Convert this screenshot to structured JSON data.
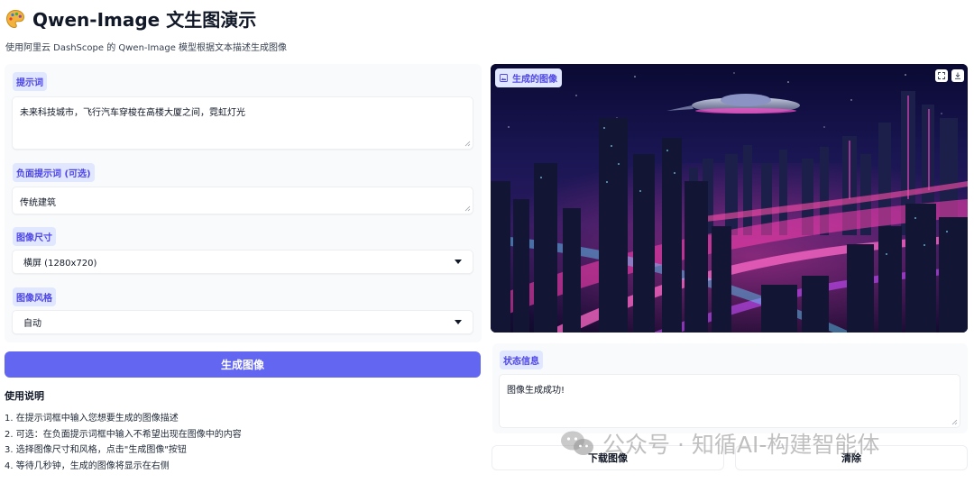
{
  "header": {
    "title": "Qwen-Image 文生图演示",
    "subtitle": "使用阿里云 DashScope 的 Qwen-Image 模型根据文本描述生成图像"
  },
  "form": {
    "prompt": {
      "label": "提示词",
      "value": "未来科技城市，飞行汽车穿梭在高楼大厦之间，霓虹灯光"
    },
    "negative_prompt": {
      "label": "负面提示词 (可选)",
      "value": "传统建筑"
    },
    "size": {
      "label": "图像尺寸",
      "selected": "横屏 (1280x720)"
    },
    "style": {
      "label": "图像风格",
      "selected": "自动"
    },
    "generate_button": "生成图像"
  },
  "usage": {
    "title": "使用说明",
    "steps": [
      "1. 在提示词框中输入您想要生成的图像描述",
      "2. 可选：在负面提示词框中输入不希望出现在图像中的内容",
      "3. 选择图像尺寸和风格，点击\"生成图像\"按钮",
      "4. 等待几秒钟，生成的图像将显示在右侧"
    ]
  },
  "output": {
    "image_label": "生成的图像",
    "status_label": "状态信息",
    "status_text": "图像生成成功!",
    "download_button": "下载图像",
    "clear_button": "清除"
  },
  "watermark": "公众号 · 知循AI-构建智能体",
  "icons": {
    "header": "palette-icon",
    "image_label": "image-icon",
    "fullscreen": "fullscreen-icon",
    "download": "download-icon",
    "watermark": "wechat-icon"
  },
  "colors": {
    "accent": "#6366f1",
    "label_bg": "#e0e7ff",
    "label_text": "#4f46e5"
  }
}
